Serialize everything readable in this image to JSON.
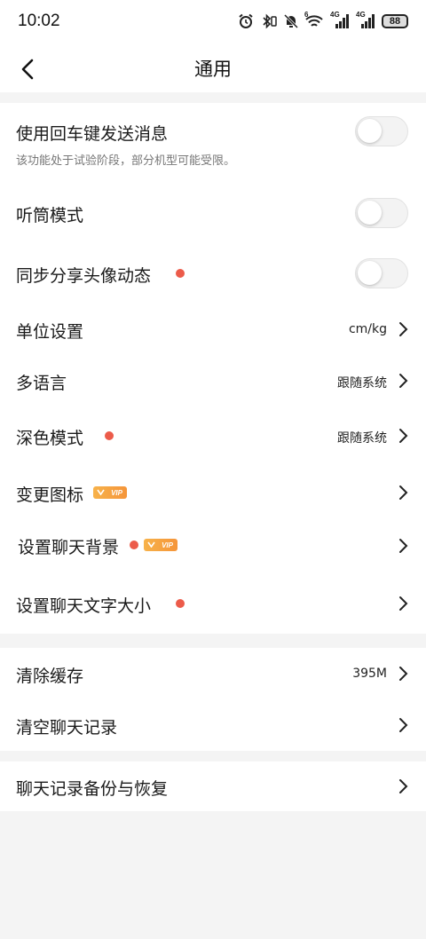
{
  "status": {
    "time": "10:02",
    "signal1_label": "4G",
    "signal2_label": "4G",
    "wifi_label": "6",
    "battery": "88"
  },
  "header": {
    "title": "通用"
  },
  "settings": {
    "enter_send": {
      "label": "使用回车键发送消息",
      "desc": "该功能处于试验阶段，部分机型可能受限。",
      "on": false
    },
    "receiver_mode": {
      "label": "听筒模式",
      "on": false
    },
    "sync_avatar": {
      "label": "同步分享头像动态",
      "on": false,
      "new_dot": true
    },
    "units": {
      "label": "单位设置",
      "value": "cm/kg"
    },
    "language": {
      "label": "多语言",
      "value": "跟随系统"
    },
    "dark_mode": {
      "label": "深色模式",
      "value": "跟随系统",
      "new_dot": true
    },
    "change_icon": {
      "label": "变更图标",
      "badge": "VIP"
    },
    "chat_background": {
      "label": "设置聊天背景",
      "badge": "VIP",
      "new_dot": true
    },
    "chat_font_size": {
      "label": "设置聊天文字大小",
      "new_dot": true
    }
  },
  "storage": {
    "clear_cache": {
      "label": "清除缓存",
      "value": "395M"
    },
    "clear_history": {
      "label": "清空聊天记录"
    }
  },
  "backup": {
    "backup_restore": {
      "label": "聊天记录备份与恢复"
    }
  },
  "colors": {
    "accent_dot": "#ec5b4a",
    "vip_badge": "#f5a03f",
    "page_bg": "#f4f4f4"
  }
}
